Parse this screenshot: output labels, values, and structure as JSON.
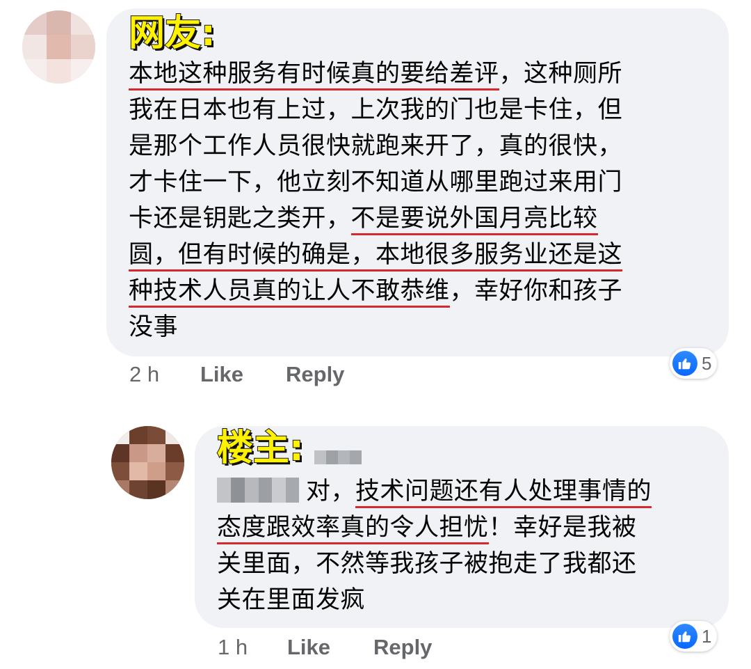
{
  "comments": [
    {
      "label": "网友:",
      "lines": [
        [
          "本地这种服务有时候真的要给差评",
          "，这种厕所"
        ],
        [
          "我在日本也有上过，上次我的门也是卡住，但"
        ],
        [
          "是那个工作人员很快就跑来开了，真的很快，"
        ],
        [
          "才卡住一下，他立刻不知道从哪里跑过来用门"
        ],
        [
          "卡还是钥匙之类开，",
          "不是要说外国月亮比较"
        ],
        [
          "圆，但有时候的确是，本地很多服务业还是这"
        ],
        [
          "种技术人员真的让人不敢恭维",
          "，幸好你和孩子"
        ],
        [
          "没事"
        ]
      ],
      "time": "2 h",
      "like": "Like",
      "reply": "Reply",
      "reactions": "5"
    },
    {
      "label": "楼主:",
      "lines": [
        [
          "对，",
          "技术问题还有人处理事情的"
        ],
        [
          "态度跟效率真的令人担忧",
          "！幸好是我被"
        ],
        [
          "关里面，不然等我孩子被抱走了我都还"
        ],
        [
          "关在里面发疯"
        ]
      ],
      "time": "1 h",
      "like": "Like",
      "reply": "Reply",
      "reactions": "1"
    }
  ],
  "colors": {
    "bubble": "#f0f2f5",
    "highlight_tag": "#fff200",
    "underline": "#d6282f",
    "meta_text": "#65676b",
    "like_blue": "#0866ff"
  },
  "icons": [
    "avatar-pixelated",
    "thumbs-up-icon"
  ]
}
